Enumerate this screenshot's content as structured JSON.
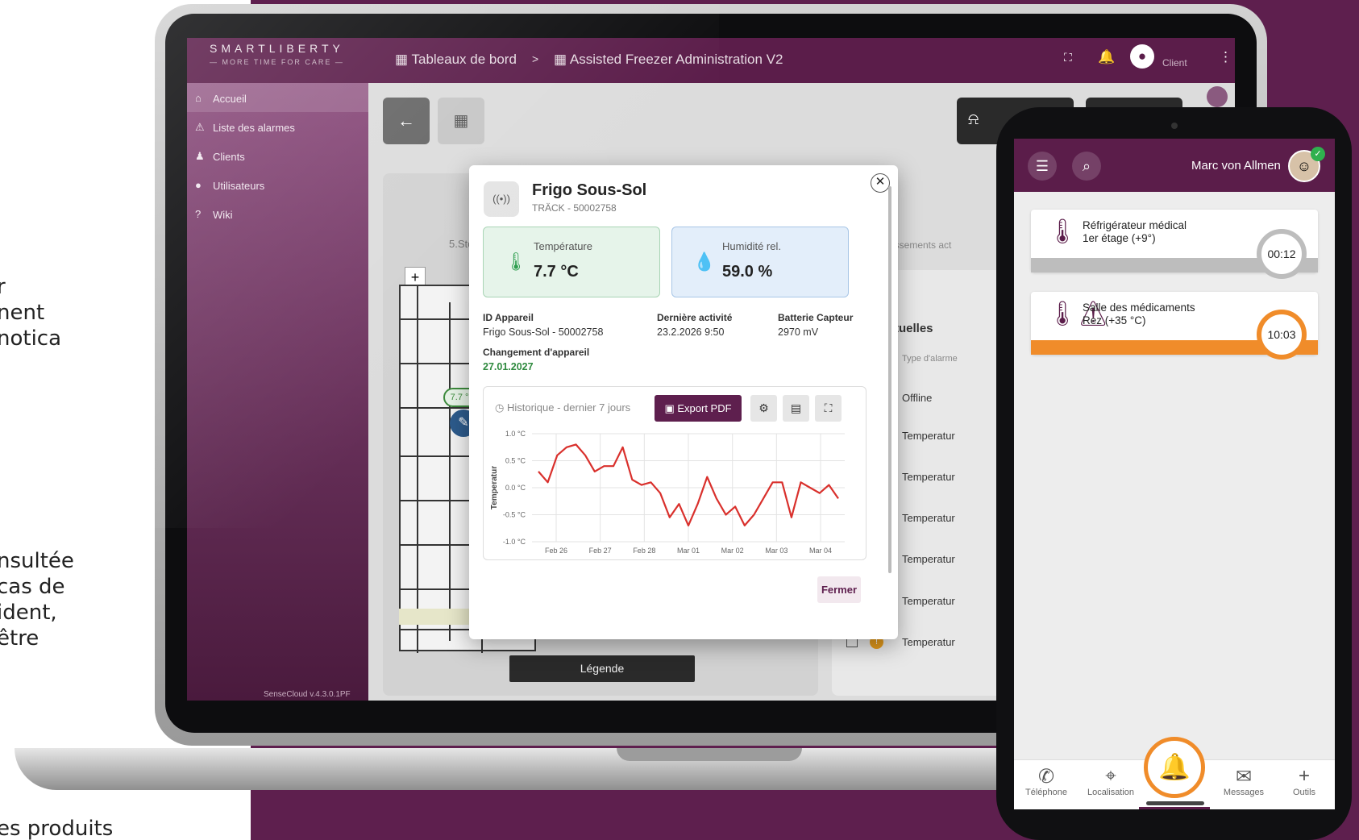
{
  "side_text": {
    "block1": [
      "r",
      "nent",
      "notica"
    ],
    "block2": [
      "nsultée",
      " cas de",
      "ident,",
      "être"
    ],
    "block3": "es produits"
  },
  "app": {
    "logo_main": "SMARTLIBERTY",
    "logo_sub": "— MORE TIME FOR CARE —",
    "breadcrumb": [
      "Tableaux de bord",
      ">",
      "Assisted Freezer Administration V2"
    ],
    "user_label": "Client",
    "version": "SenseCloud v.4.3.0.1PF",
    "sidebar": [
      {
        "icon": "home-icon",
        "glyph": "⌂",
        "label": "Accueil"
      },
      {
        "icon": "warning-icon",
        "glyph": "⚠",
        "label": "Liste des alarmes"
      },
      {
        "icon": "people-icon",
        "glyph": "♟",
        "label": "Clients"
      },
      {
        "icon": "user-icon",
        "glyph": "●",
        "label": "Utilisateurs"
      },
      {
        "icon": "help-icon",
        "glyph": "?",
        "label": "Wiki"
      }
    ],
    "floor_label": "5.Stock",
    "temp_pin": "7.7 °C",
    "legend": "Légende",
    "right_panel": {
      "header_partial": "issements act",
      "title_partial": "tuelles",
      "col": "Type d'alarme",
      "rows": [
        "Offline",
        "Temperatur",
        "Temperatur",
        "Temperatur",
        "Temperatur",
        "Temperatur",
        "Temperatur"
      ]
    }
  },
  "modal": {
    "title": "Frigo Sous-Sol",
    "subtitle": "TRÄCK - 50002758",
    "temp_label": "Température",
    "temp_value": "7.7 °C",
    "hum_label": "Humidité rel.",
    "hum_value": "59.0 %",
    "id_label": "ID Appareil",
    "id_value": "Frigo Sous-Sol - 50002758",
    "last_label": "Dernière activité",
    "last_value": "23.2.2026 9:50",
    "battery_label": "Batterie Capteur",
    "battery_value": "2970 mV",
    "change_label": "Changement d'appareil",
    "change_value": "27.01.2027",
    "history_title": "Historique - dernier 7 jours",
    "export": "Export PDF",
    "close": "Fermer",
    "accent": "#5e1f4e"
  },
  "chart_data": {
    "type": "line",
    "ylabel": "Temperatur",
    "yticks": [
      "1.0 °C",
      "0.5 °C",
      "0.0 °C",
      "-0.5 °C",
      "-1.0 °C"
    ],
    "xticks": [
      "Feb 26",
      "Feb 27",
      "Feb 28",
      "Mar 01",
      "Mar 02",
      "Mar 03",
      "Mar 04"
    ],
    "ylim": [
      -1.0,
      1.0
    ],
    "series": [
      {
        "color": "#d9302c",
        "values": [
          0.3,
          0.1,
          0.6,
          0.75,
          0.8,
          0.6,
          0.3,
          0.4,
          0.4,
          0.75,
          0.15,
          0.05,
          0.1,
          -0.1,
          -0.55,
          -0.3,
          -0.7,
          -0.3,
          0.2,
          -0.2,
          -0.5,
          -0.35,
          -0.7,
          -0.5,
          -0.2,
          0.1,
          0.1,
          -0.55,
          0.1,
          0.0,
          -0.1,
          0.05,
          -0.2
        ]
      }
    ]
  },
  "phone": {
    "user": "Marc von Allmen",
    "alarms": [
      {
        "name": "Réfrigérateur médical",
        "sub": "1er étage (+9°)",
        "time": "00:12",
        "color": "#bdbdbd"
      },
      {
        "name": "Salle des médicaments",
        "sub": "Rez (+35 °C)",
        "time": "10:03",
        "color": "#f08c2a"
      }
    ],
    "tabs": [
      "Téléphone",
      "Localisation",
      "Messages",
      "Outils"
    ]
  }
}
